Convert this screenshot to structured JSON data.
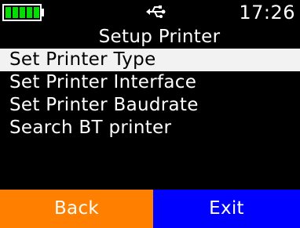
{
  "status_bar": {
    "battery_level": 1.0,
    "battery_icon": "battery-full-icon",
    "usb_icon": "usb-icon",
    "time": "17:26"
  },
  "title": "Setup Printer",
  "menu": {
    "selected_index": 0,
    "items": [
      {
        "label": "Set Printer Type"
      },
      {
        "label": "Set Printer Interface"
      },
      {
        "label": "Set Printer Baudrate"
      },
      {
        "label": "Search BT printer"
      }
    ]
  },
  "softkeys": {
    "left": {
      "label": "Back",
      "color": "#ff8000"
    },
    "right": {
      "label": "Exit",
      "color": "#0000ff"
    }
  },
  "colors": {
    "background": "#000000",
    "text": "#ffffff",
    "selection": "#f2f2f2",
    "battery": "#00e000"
  }
}
